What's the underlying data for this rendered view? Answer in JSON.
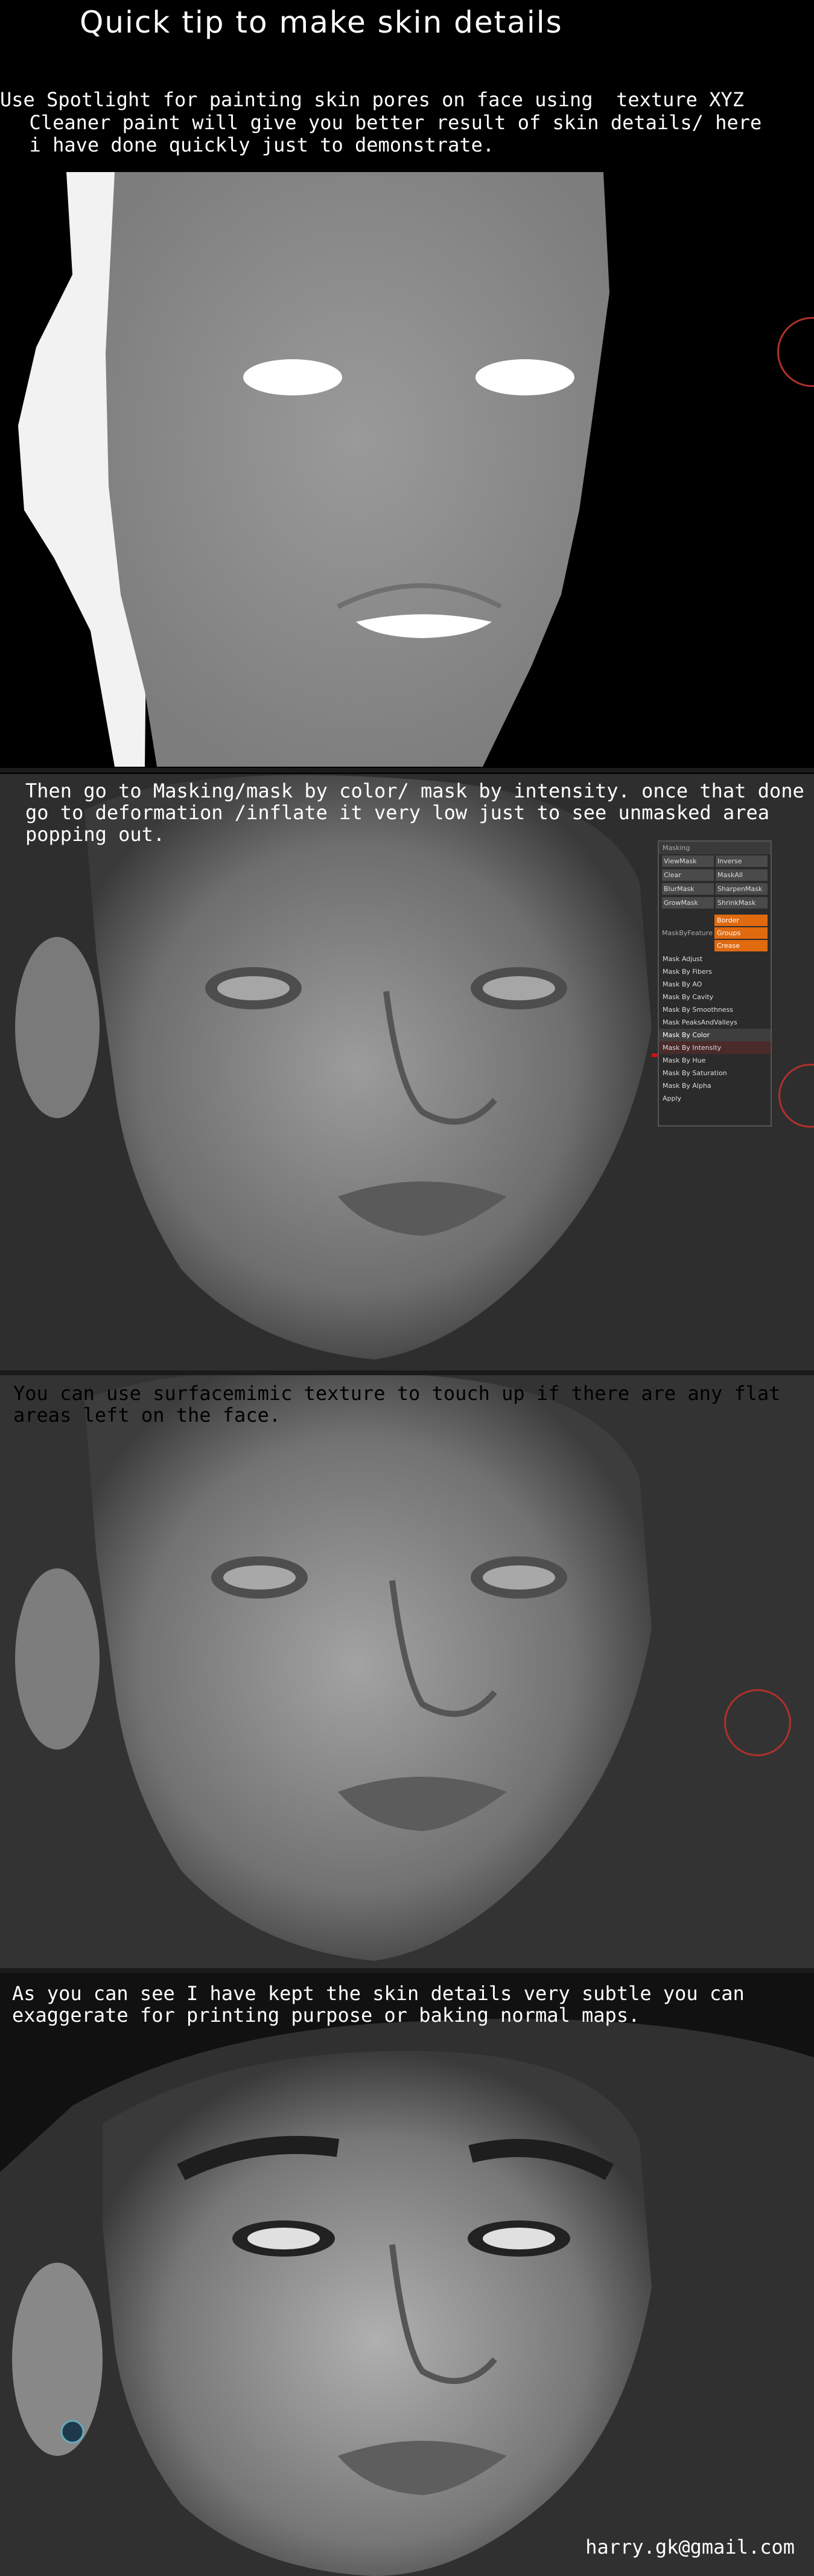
{
  "title": "Quick tip to make skin details",
  "intro": {
    "line1": "Use Spotlight for painting skin pores on face using  texture XYZ",
    "line2": "  Cleaner paint will give you better result of skin details/ here",
    "line3": "  i have done quickly just to demonstrate."
  },
  "panel2": {
    "line1": "Then go to Masking/mask by color/ mask by intensity. once that done",
    "line2": "go to deformation /inflate it very low just to see unmasked area",
    "line3": "popping out."
  },
  "menu": {
    "header": "Masking",
    "rows": [
      [
        "ViewMask",
        "Inverse"
      ],
      [
        "Clear",
        "MaskAll"
      ],
      [
        "BlurMask",
        "SharpenMask"
      ],
      [
        "GrowMask",
        "ShrinkMask"
      ]
    ],
    "falloff_label": "MaskByFeature",
    "orange_buttons": [
      "Border",
      "Groups",
      "Crease"
    ],
    "items": [
      "Mask Adjust",
      "Mask By Fibers",
      "Mask By AO",
      "Mask By Cavity",
      "Mask By Smoothness",
      "Mask PeaksAndValleys",
      "Mask By Color",
      "Mask By Intensity",
      "Mask By Hue",
      "Mask By Saturation",
      "Mask By Alpha",
      "Apply"
    ]
  },
  "panel3": {
    "line1": "You can use surfacemimic texture to touch up if there are any flat",
    "line2": "areas left on the face."
  },
  "panel4": {
    "line1": "As you can see I have kept the skin details very subtle you can",
    "line2": "exaggerate for printing purpose or baking normal maps."
  },
  "email": "harry.gk@gmail.com",
  "colors": {
    "accent_orange": "#e06a10",
    "ring_red": "#b0302a"
  }
}
